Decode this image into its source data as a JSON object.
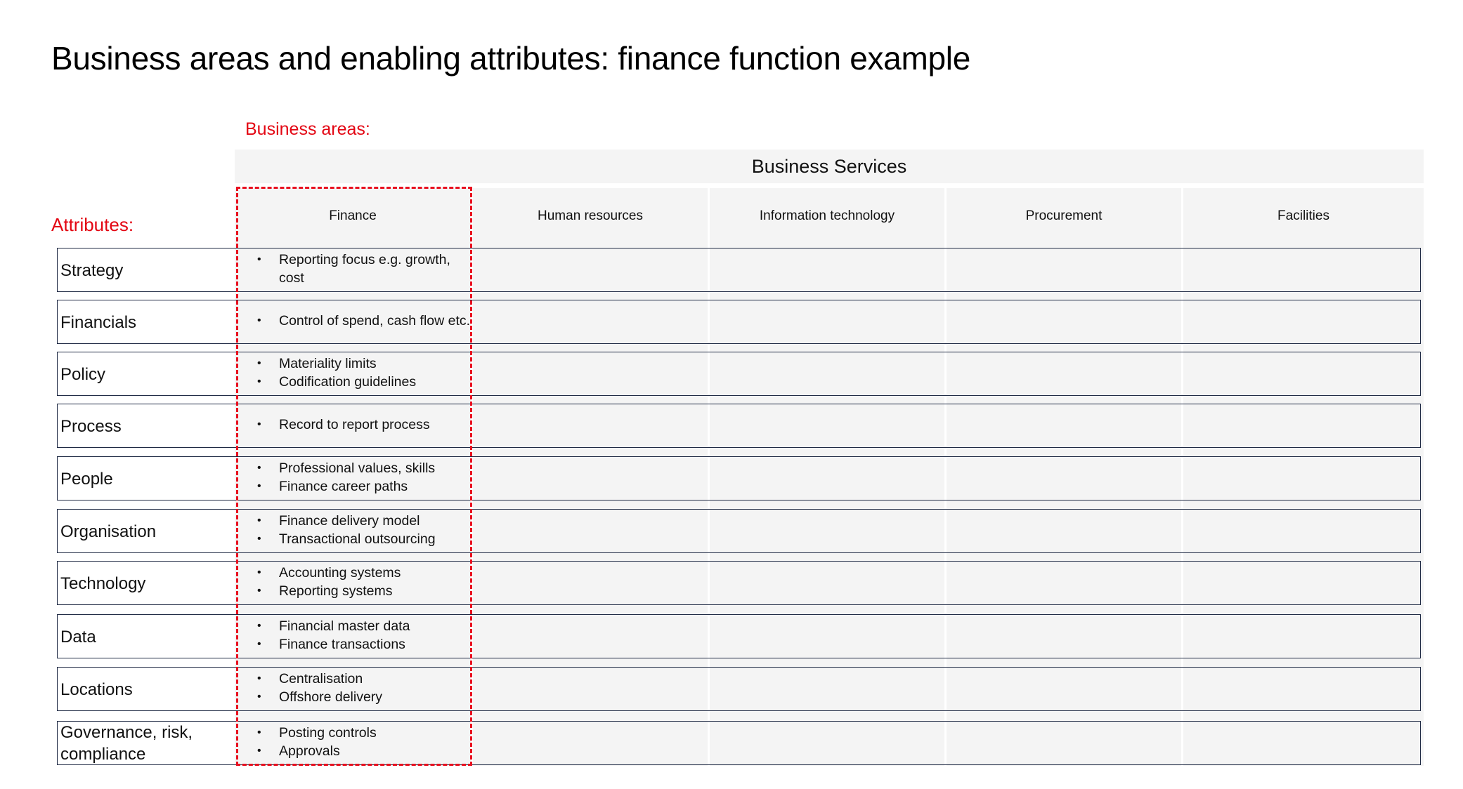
{
  "title": "Business areas and enabling attributes: finance function example",
  "labels": {
    "business_areas": "Business areas:",
    "attributes": "Attributes:"
  },
  "business_services": {
    "title": "Business Services",
    "columns": [
      "Finance",
      "Human resources",
      "Information technology",
      "Procurement",
      "Facilities"
    ],
    "highlighted_column": "Finance"
  },
  "attributes": [
    {
      "label": "Strategy",
      "finance": [
        "Reporting focus e.g. growth, cost"
      ]
    },
    {
      "label": "Financials",
      "finance": [
        "Control of spend, cash flow etc."
      ]
    },
    {
      "label": "Policy",
      "finance": [
        "Materiality limits",
        "Codification guidelines"
      ]
    },
    {
      "label": "Process",
      "finance": [
        "Record to report process"
      ]
    },
    {
      "label": "People",
      "finance": [
        "Professional values, skills",
        "Finance career paths"
      ]
    },
    {
      "label": "Organisation",
      "finance": [
        "Finance delivery model",
        "Transactional outsourcing"
      ]
    },
    {
      "label": "Technology",
      "finance": [
        "Accounting systems",
        "Reporting systems"
      ]
    },
    {
      "label": "Data",
      "finance": [
        "Financial master data",
        "Finance transactions"
      ]
    },
    {
      "label": "Locations",
      "finance": [
        "Centralisation",
        "Offshore delivery"
      ]
    },
    {
      "label": "Governance, risk, compliance",
      "finance": [
        "Posting controls",
        "Approvals"
      ]
    }
  ],
  "colors": {
    "accent_red": "#e30613",
    "cell_gray": "#f4f4f4",
    "row_border": "#1f2a44"
  },
  "bullet_glyph": "•"
}
